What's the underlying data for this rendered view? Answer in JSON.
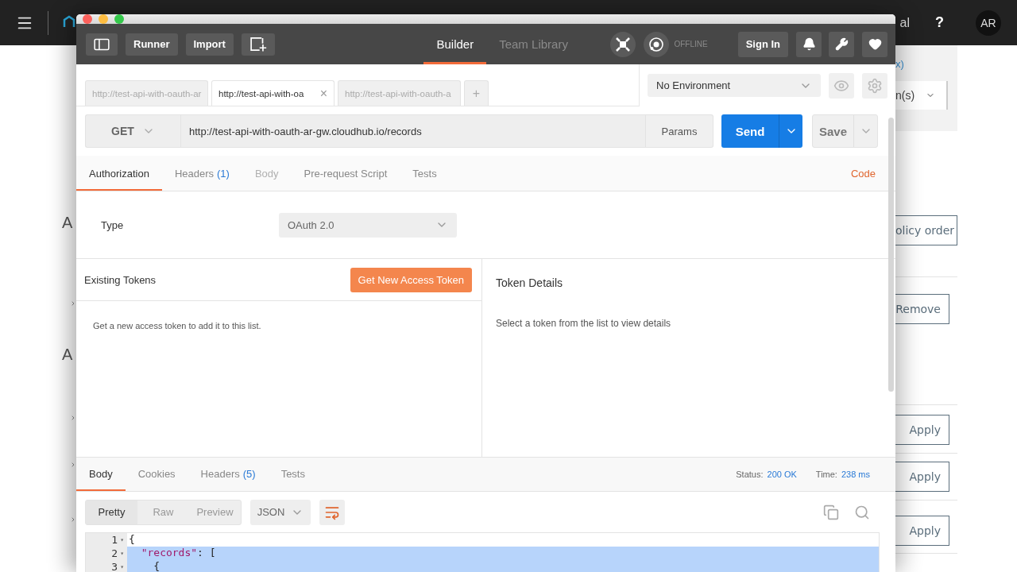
{
  "background_page": {
    "header": {
      "link_fragment": "al",
      "help": "?",
      "avatar": "AR"
    },
    "left_fragments": [
      "A",
      "A"
    ],
    "right_panel": {
      "link_fragment": "x)",
      "select_fragment": "n(s)"
    },
    "buttons": [
      {
        "label": "olicy order"
      },
      {
        "label": "Remove"
      },
      {
        "label": "Apply"
      },
      {
        "label": "Apply"
      },
      {
        "label": "Apply"
      }
    ]
  },
  "window": {
    "toolbar": {
      "buttons": [
        "Runner",
        "Import"
      ],
      "tabs": [
        {
          "label": "Builder",
          "selected": true
        },
        {
          "label": "Team Library",
          "selected": false
        }
      ],
      "status": "OFFLINE",
      "sign_in": "Sign In"
    },
    "request_tabs": [
      {
        "label": "http://test-api-with-oauth-ar",
        "selected": false
      },
      {
        "label": "http://test-api-with-oa",
        "selected": true,
        "close": "×"
      },
      {
        "label": "http://test-api-with-oauth-a",
        "selected": false
      }
    ],
    "new_tab": "+",
    "environment": "No Environment",
    "request": {
      "method": "GET",
      "url": "http://test-api-with-oauth-ar-gw.cloudhub.io/records",
      "params": "Params",
      "send": "Send",
      "save": "Save"
    },
    "request_sections": [
      {
        "label": "Authorization",
        "selected": true,
        "disabled": false
      },
      {
        "label": "Headers",
        "count": "(1)",
        "selected": false,
        "disabled": false
      },
      {
        "label": "Body",
        "selected": false,
        "disabled": true
      },
      {
        "label": "Pre-request Script",
        "selected": false,
        "disabled": false
      },
      {
        "label": "Tests",
        "selected": false,
        "disabled": false
      }
    ],
    "code_link": "Code",
    "auth": {
      "type_label": "Type",
      "type_value": "OAuth 2.0"
    },
    "tokens": {
      "title": "Existing Tokens",
      "button": "Get New Access Token",
      "empty": "Get a new access token to add it to this list.",
      "details_title": "Token Details",
      "details_empty": "Select a token from the list to view details"
    },
    "response_tabs": [
      {
        "label": "Body",
        "selected": true
      },
      {
        "label": "Cookies",
        "selected": false
      },
      {
        "label": "Headers",
        "count": "(5)",
        "selected": false
      },
      {
        "label": "Tests",
        "selected": false
      }
    ],
    "status": {
      "status_label": "Status:",
      "status_value": "200 OK",
      "time_label": "Time:",
      "time_value": "238 ms"
    },
    "view_modes": [
      {
        "label": "Pretty",
        "selected": true
      },
      {
        "label": "Raw",
        "selected": false
      },
      {
        "label": "Preview",
        "selected": false
      }
    ],
    "format": "JSON",
    "code_lines": [
      {
        "number": "1",
        "fold": "▾",
        "selected": false,
        "tokens": [
          {
            "text": "{"
          }
        ]
      },
      {
        "number": "2",
        "fold": "▾",
        "selected": true,
        "tokens": [
          {
            "text": "  \"records\"",
            "kind": "string"
          },
          {
            "text": ": ["
          }
        ]
      },
      {
        "number": "3",
        "fold": "▾",
        "selected": true,
        "tokens": [
          {
            "text": "    {"
          }
        ]
      }
    ]
  }
}
